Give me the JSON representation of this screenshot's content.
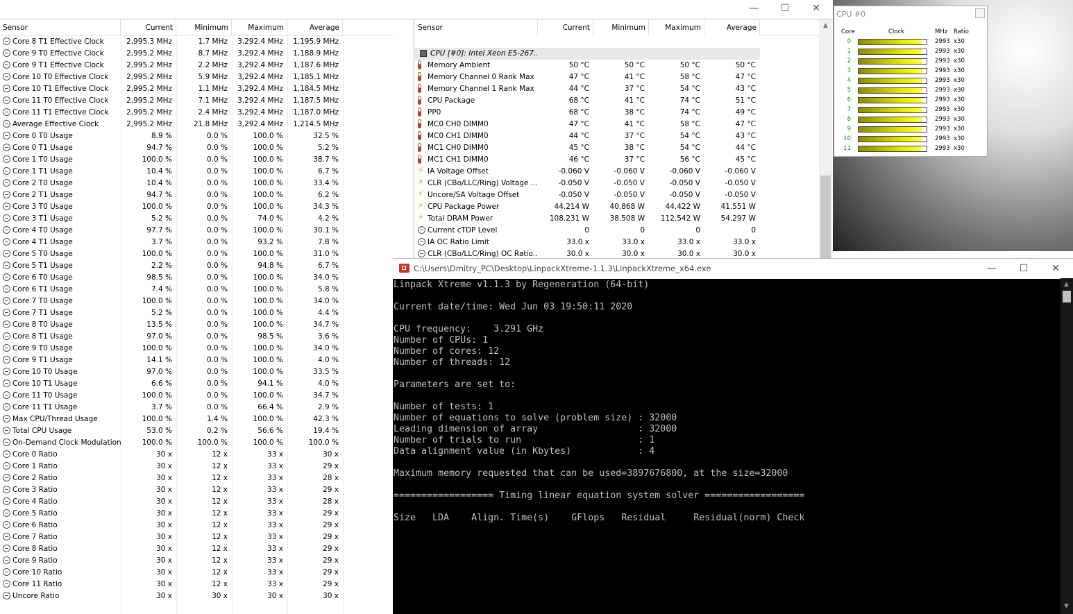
{
  "left_panel": {
    "headers": [
      "Sensor",
      "Current",
      "Minimum",
      "Maximum",
      "Average"
    ],
    "rows": [
      [
        "c",
        "Core 8 T1 Effective Clock",
        "2,995.3 MHz",
        "1.7 MHz",
        "3,292.4 MHz",
        "1,195.9 MHz"
      ],
      [
        "c",
        "Core 9 T0 Effective Clock",
        "2,995.2 MHz",
        "8.7 MHz",
        "3,292.4 MHz",
        "1,188.9 MHz"
      ],
      [
        "c",
        "Core 9 T1 Effective Clock",
        "2,995.2 MHz",
        "2.2 MHz",
        "3,292.4 MHz",
        "1,187.6 MHz"
      ],
      [
        "c",
        "Core 10 T0 Effective Clock",
        "2,995.2 MHz",
        "5.9 MHz",
        "3,292.4 MHz",
        "1,185.1 MHz"
      ],
      [
        "c",
        "Core 10 T1 Effective Clock",
        "2,995.2 MHz",
        "1.1 MHz",
        "3,292.4 MHz",
        "1,184.5 MHz"
      ],
      [
        "c",
        "Core 11 T0 Effective Clock",
        "2,995.2 MHz",
        "7.1 MHz",
        "3,292.4 MHz",
        "1,187.5 MHz"
      ],
      [
        "c",
        "Core 11 T1 Effective Clock",
        "2,995.2 MHz",
        "2.4 MHz",
        "3,292.4 MHz",
        "1,187.0 MHz"
      ],
      [
        "c",
        "Average Effective Clock",
        "2,995.2 MHz",
        "21.8 MHz",
        "3,292.4 MHz",
        "1,214.5 MHz"
      ],
      [
        "c",
        "Core 0 T0 Usage",
        "8.9 %",
        "0.0 %",
        "100.0 %",
        "32.5 %"
      ],
      [
        "c",
        "Core 0 T1 Usage",
        "94.7 %",
        "0.0 %",
        "100.0 %",
        "5.2 %"
      ],
      [
        "c",
        "Core 1 T0 Usage",
        "100.0 %",
        "0.0 %",
        "100.0 %",
        "38.7 %"
      ],
      [
        "c",
        "Core 1 T1 Usage",
        "10.4 %",
        "0.0 %",
        "100.0 %",
        "6.7 %"
      ],
      [
        "c",
        "Core 2 T0 Usage",
        "10.4 %",
        "0.0 %",
        "100.0 %",
        "33.4 %"
      ],
      [
        "c",
        "Core 2 T1 Usage",
        "94.7 %",
        "0.0 %",
        "100.0 %",
        "6.2 %"
      ],
      [
        "c",
        "Core 3 T0 Usage",
        "100.0 %",
        "0.0 %",
        "100.0 %",
        "34.3 %"
      ],
      [
        "c",
        "Core 3 T1 Usage",
        "5.2 %",
        "0.0 %",
        "74.0 %",
        "4.2 %"
      ],
      [
        "c",
        "Core 4 T0 Usage",
        "97.7 %",
        "0.0 %",
        "100.0 %",
        "30.1 %"
      ],
      [
        "c",
        "Core 4 T1 Usage",
        "3.7 %",
        "0.0 %",
        "93.2 %",
        "7.8 %"
      ],
      [
        "c",
        "Core 5 T0 Usage",
        "100.0 %",
        "0.0 %",
        "100.0 %",
        "31.0 %"
      ],
      [
        "c",
        "Core 5 T1 Usage",
        "2.2 %",
        "0.0 %",
        "94.8 %",
        "6.7 %"
      ],
      [
        "c",
        "Core 6 T0 Usage",
        "98.5 %",
        "0.0 %",
        "100.0 %",
        "34.0 %"
      ],
      [
        "c",
        "Core 6 T1 Usage",
        "7.4 %",
        "0.0 %",
        "100.0 %",
        "5.8 %"
      ],
      [
        "c",
        "Core 7 T0 Usage",
        "100.0 %",
        "0.0 %",
        "100.0 %",
        "34.0 %"
      ],
      [
        "c",
        "Core 7 T1 Usage",
        "5.2 %",
        "0.0 %",
        "100.0 %",
        "4.4 %"
      ],
      [
        "c",
        "Core 8 T0 Usage",
        "13.5 %",
        "0.0 %",
        "100.0 %",
        "34.7 %"
      ],
      [
        "c",
        "Core 8 T1 Usage",
        "97.0 %",
        "0.0 %",
        "98.5 %",
        "3.6 %"
      ],
      [
        "c",
        "Core 9 T0 Usage",
        "100.0 %",
        "0.0 %",
        "100.0 %",
        "34.0 %"
      ],
      [
        "c",
        "Core 9 T1 Usage",
        "14.1 %",
        "0.0 %",
        "100.0 %",
        "4.0 %"
      ],
      [
        "c",
        "Core 10 T0 Usage",
        "97.0 %",
        "0.0 %",
        "100.0 %",
        "33.5 %"
      ],
      [
        "c",
        "Core 10 T1 Usage",
        "6.6 %",
        "0.0 %",
        "94.1 %",
        "4.0 %"
      ],
      [
        "c",
        "Core 11 T0 Usage",
        "100.0 %",
        "0.0 %",
        "100.0 %",
        "34.7 %"
      ],
      [
        "c",
        "Core 11 T1 Usage",
        "3.7 %",
        "0.0 %",
        "66.4 %",
        "2.9 %"
      ],
      [
        "c",
        "Max CPU/Thread Usage",
        "100.0 %",
        "1.4 %",
        "100.0 %",
        "42.3 %"
      ],
      [
        "c",
        "Total CPU Usage",
        "53.0 %",
        "0.2 %",
        "56.6 %",
        "19.4 %"
      ],
      [
        "c",
        "On-Demand Clock Modulation",
        "100.0 %",
        "100.0 %",
        "100.0 %",
        "100.0 %"
      ],
      [
        "c",
        "Core 0 Ratio",
        "30 x",
        "12 x",
        "33 x",
        "30 x"
      ],
      [
        "c",
        "Core 1 Ratio",
        "30 x",
        "12 x",
        "33 x",
        "29 x"
      ],
      [
        "c",
        "Core 2 Ratio",
        "30 x",
        "12 x",
        "33 x",
        "28 x"
      ],
      [
        "c",
        "Core 3 Ratio",
        "30 x",
        "12 x",
        "33 x",
        "29 x"
      ],
      [
        "c",
        "Core 4 Ratio",
        "30 x",
        "12 x",
        "33 x",
        "28 x"
      ],
      [
        "c",
        "Core 5 Ratio",
        "30 x",
        "12 x",
        "33 x",
        "29 x"
      ],
      [
        "c",
        "Core 6 Ratio",
        "30 x",
        "12 x",
        "33 x",
        "29 x"
      ],
      [
        "c",
        "Core 7 Ratio",
        "30 x",
        "12 x",
        "33 x",
        "29 x"
      ],
      [
        "c",
        "Core 8 Ratio",
        "30 x",
        "12 x",
        "33 x",
        "29 x"
      ],
      [
        "c",
        "Core 9 Ratio",
        "30 x",
        "12 x",
        "33 x",
        "29 x"
      ],
      [
        "c",
        "Core 10 Ratio",
        "30 x",
        "12 x",
        "33 x",
        "29 x"
      ],
      [
        "c",
        "Core 11 Ratio",
        "30 x",
        "12 x",
        "33 x",
        "29 x"
      ],
      [
        "c",
        "Uncore Ratio",
        "30 x",
        "30 x",
        "30 x",
        "30 x"
      ]
    ]
  },
  "right_panel": {
    "headers": [
      "Sensor",
      "Current",
      "Minimum",
      "Maximum",
      "Average"
    ],
    "group_title": "CPU [#0]: Intel Xeon E5-267...",
    "rows": [
      [
        "t",
        "Memory Ambient",
        "50 °C",
        "50 °C",
        "50 °C",
        "50 °C"
      ],
      [
        "t",
        "Memory Channel 0 Rank Max",
        "47 °C",
        "41 °C",
        "58 °C",
        "47 °C"
      ],
      [
        "t",
        "Memory Channel 1 Rank Max",
        "44 °C",
        "37 °C",
        "54 °C",
        "43 °C"
      ],
      [
        "t",
        "CPU Package",
        "68 °C",
        "41 °C",
        "74 °C",
        "51 °C"
      ],
      [
        "t",
        "PP0",
        "68 °C",
        "38 °C",
        "74 °C",
        "49 °C"
      ],
      [
        "t",
        "MC0 CH0 DIMM0",
        "47 °C",
        "41 °C",
        "58 °C",
        "47 °C"
      ],
      [
        "t",
        "MC0 CH1 DIMM0",
        "44 °C",
        "37 °C",
        "54 °C",
        "43 °C"
      ],
      [
        "t",
        "MC1 CH0 DIMM0",
        "45 °C",
        "38 °C",
        "54 °C",
        "44 °C"
      ],
      [
        "t",
        "MC1 CH1 DIMM0",
        "46 °C",
        "37 °C",
        "56 °C",
        "45 °C"
      ],
      [
        "b",
        "IA Voltage Offset",
        "-0.060 V",
        "-0.060 V",
        "-0.060 V",
        "-0.060 V"
      ],
      [
        "b",
        "CLR (CBo/LLC/Ring) Voltage ...",
        "-0.050 V",
        "-0.050 V",
        "-0.050 V",
        "-0.050 V"
      ],
      [
        "b",
        "Uncore/SA Voltage Offset",
        "-0.050 V",
        "-0.050 V",
        "-0.050 V",
        "-0.050 V"
      ],
      [
        "b",
        "CPU Package Power",
        "44.214 W",
        "40.868 W",
        "44.422 W",
        "41.551 W"
      ],
      [
        "b",
        "Total DRAM Power",
        "108.231 W",
        "38.508 W",
        "112.542 W",
        "54.297 W"
      ],
      [
        "c",
        "Current cTDP Level",
        "0",
        "0",
        "0",
        "0"
      ],
      [
        "c",
        "IA OC Ratio Limit",
        "33.0 x",
        "33.0 x",
        "33.0 x",
        "33.0 x"
      ],
      [
        "c",
        "CLR (CBo/LLC/Ring) OC Ratio...",
        "30.0 x",
        "30.0 x",
        "30.0 x",
        "30.0 x"
      ]
    ]
  },
  "window_controls": {
    "minimize": "—",
    "maximize": "☐",
    "close": "✕"
  },
  "cpu_widget": {
    "title": "CPU #0",
    "headers": [
      "Core",
      "Clock",
      "MHz",
      "Ratio"
    ],
    "cores": [
      {
        "core": "0",
        "mhz": "2993",
        "ratio": "x30",
        "fill": 0.93
      },
      {
        "core": "1",
        "mhz": "2993",
        "ratio": "x30",
        "fill": 0.93
      },
      {
        "core": "2",
        "mhz": "2993",
        "ratio": "x30",
        "fill": 0.93
      },
      {
        "core": "3",
        "mhz": "2993",
        "ratio": "x30",
        "fill": 0.93
      },
      {
        "core": "4",
        "mhz": "2993",
        "ratio": "x30",
        "fill": 0.93
      },
      {
        "core": "5",
        "mhz": "2993",
        "ratio": "x30",
        "fill": 0.93
      },
      {
        "core": "6",
        "mhz": "2993",
        "ratio": "x30",
        "fill": 0.93
      },
      {
        "core": "7",
        "mhz": "2993",
        "ratio": "x30",
        "fill": 0.93
      },
      {
        "core": "8",
        "mhz": "2993",
        "ratio": "x30",
        "fill": 0.93
      },
      {
        "core": "9",
        "mhz": "2993",
        "ratio": "x30",
        "fill": 0.93
      },
      {
        "core": "10",
        "mhz": "2993",
        "ratio": "x30",
        "fill": 0.93
      },
      {
        "core": "11",
        "mhz": "2993",
        "ratio": "x30",
        "fill": 0.93
      }
    ]
  },
  "console": {
    "title": "C:\\Users\\Dmitry_PC\\Desktop\\LinpackXtreme-1.1.3\\LinpackXtreme_x64.exe",
    "lines": [
      "Linpack Xtreme v1.1.3 by Regeneration (64-bit)",
      "",
      "Current date/time: Wed Jun 03 19:50:11 2020",
      "",
      "CPU frequency:    3.291 GHz",
      "Number of CPUs: 1",
      "Number of cores: 12",
      "Number of threads: 12",
      "",
      "Parameters are set to:",
      "",
      "Number of tests: 1",
      "Number of equations to solve (problem size) : 32000",
      "Leading dimension of array                  : 32000",
      "Number of trials to run                     : 1",
      "Data alignment value (in Kbytes)            : 4",
      "",
      "Maximum memory requested that can be used=3897676800, at the size=32000",
      "",
      "================== Timing linear equation system solver ==================",
      "",
      "Size   LDA    Align. Time(s)    GFlops   Residual     Residual(norm) Check"
    ]
  },
  "colors": {
    "accent_green": "#00a000",
    "bar_yellow": "#e8e800",
    "console_bg": "#000000",
    "console_fg": "#c0c0c0"
  }
}
